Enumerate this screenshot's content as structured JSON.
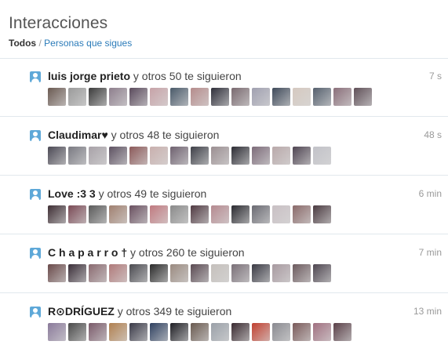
{
  "header": {
    "title": "Interacciones",
    "filter_all": "Todos",
    "filter_separator": "/",
    "filter_following": "Personas que sigues"
  },
  "icons": {
    "follow": "person-follow-icon"
  },
  "colors": {
    "icon": "#5ea8d8",
    "link": "#2b7bb9",
    "divider": "#e1e8ed"
  },
  "items": [
    {
      "name": "luis jorge prieto",
      "others_text": "y otros 50 te siguieron",
      "time": "7 s"
    },
    {
      "name": "Claudimar♥",
      "others_text": "y otros 48 te siguieron",
      "time": "48 s"
    },
    {
      "name": "Love :3 3",
      "others_text": "y otros 49 te siguieron",
      "time": "6 min"
    },
    {
      "name": "C h a p a r r o †",
      "others_text": "y otros 260 te siguieron",
      "time": "7 min"
    },
    {
      "name": "R⊙DRÍGUEZ",
      "others_text": "y otros 349 te siguieron",
      "time": "13 min"
    }
  ],
  "avatar_palettes": [
    [
      "#6b5a52",
      "#9a9a9a",
      "#3c3c3c",
      "#8e7f8d",
      "#5b4b5d",
      "#c7a3a8",
      "#4a5a6a",
      "#b58c8c",
      "#2f2f3a",
      "#7a6a70",
      "#a0a0b0",
      "#3f4a5a",
      "#d5c9c0",
      "#56606e",
      "#8a6f7a",
      "#605058"
    ],
    [
      "#4c4a55",
      "#7a7a82",
      "#a8a2a8",
      "#5e5262",
      "#8c5a5a",
      "#c9b0ae",
      "#6f6270",
      "#3e4048",
      "#9b8f92",
      "#2c2c34",
      "#7d6c7a",
      "#b9a9aa",
      "#4f4552",
      "#c2c2c8"
    ],
    [
      "#3e2e34",
      "#7a4a55",
      "#5a5a5a",
      "#a08070",
      "#6a5060",
      "#c07a80",
      "#8a8a8a",
      "#503a42",
      "#b58a90",
      "#2a2a30",
      "#6a6a72",
      "#c9c0c4",
      "#8a6a6a",
      "#4a3a40"
    ],
    [
      "#6a4a4a",
      "#3a2e38",
      "#8a6a70",
      "#b07a7a",
      "#4a4a50",
      "#2a2a2a",
      "#9a8a80",
      "#5a4a52",
      "#c5c0bc",
      "#7a7078",
      "#3a3a44",
      "#a89aa0",
      "#6c5a5e",
      "#4e4650"
    ],
    [
      "#8a7a9a",
      "#4a4a4a",
      "#7a5a6a",
      "#b08050",
      "#3a3a48",
      "#2e4060",
      "#1e1e24",
      "#6a5a50",
      "#9aa0a8",
      "#3a2a30",
      "#c04030",
      "#8a8a90",
      "#7a5a5a",
      "#a07080",
      "#5a4048"
    ]
  ]
}
